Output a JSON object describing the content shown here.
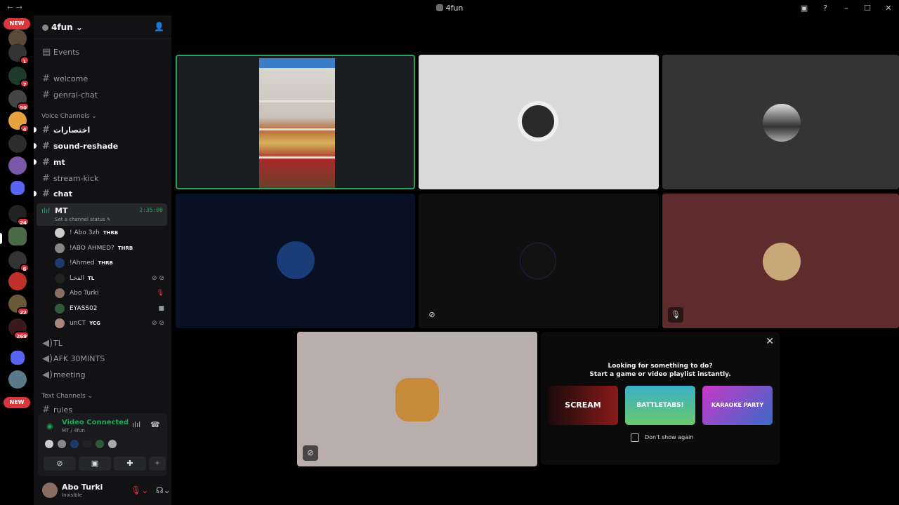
{
  "window": {
    "title": "4fun"
  },
  "servers": {
    "new_label": "NEW",
    "badges": [
      "1",
      "7",
      "50",
      "4",
      "24",
      "6",
      "22",
      "269"
    ]
  },
  "server_header": {
    "name": "4fun"
  },
  "channels": {
    "events": "Events",
    "welcome": "welcome",
    "genral_chat": "genral-chat",
    "voice_category": "Voice Channels",
    "ikhtisarat": "اختصارات",
    "sound_reshade": "sound-reshade",
    "mt_text": "mt",
    "stream_kick": "stream-kick",
    "chat": "chat",
    "active_voice": {
      "name": "MT",
      "time": "2:35:00",
      "status": "Set a channel status"
    },
    "tl": "TL",
    "afk": "AFK 30MINTS",
    "meeting": "meeting",
    "text_category": "Text Channels",
    "rules": "rules"
  },
  "members": [
    {
      "name": "! Abo 3zh",
      "tag": "THRB"
    },
    {
      "name": "!ABO AHMED?",
      "tag": "THRB"
    },
    {
      "name": "!Ahmed",
      "tag": "THRB"
    },
    {
      "name": "الفخـا",
      "tag": "TL"
    },
    {
      "name": "Abo Turki",
      "tag": ""
    },
    {
      "name": "EYASS02",
      "tag": ""
    },
    {
      "name": "unCT",
      "tag": "YCG"
    }
  ],
  "voice_panel": {
    "status": "Video Connected",
    "location": "MT / 4fun"
  },
  "user": {
    "name": "Abo Turki",
    "status": "Invisible"
  },
  "activity": {
    "line1": "Looking for something to do?",
    "line2": "Start a game or video playlist instantly.",
    "games": [
      "SCREAM",
      "BATTLETABS!",
      "KARAOKE PARTY"
    ],
    "dont_show": "Don't show again"
  },
  "colors": {
    "green": "#23a55a",
    "red": "#da373c",
    "blurple": "#5865f2"
  }
}
